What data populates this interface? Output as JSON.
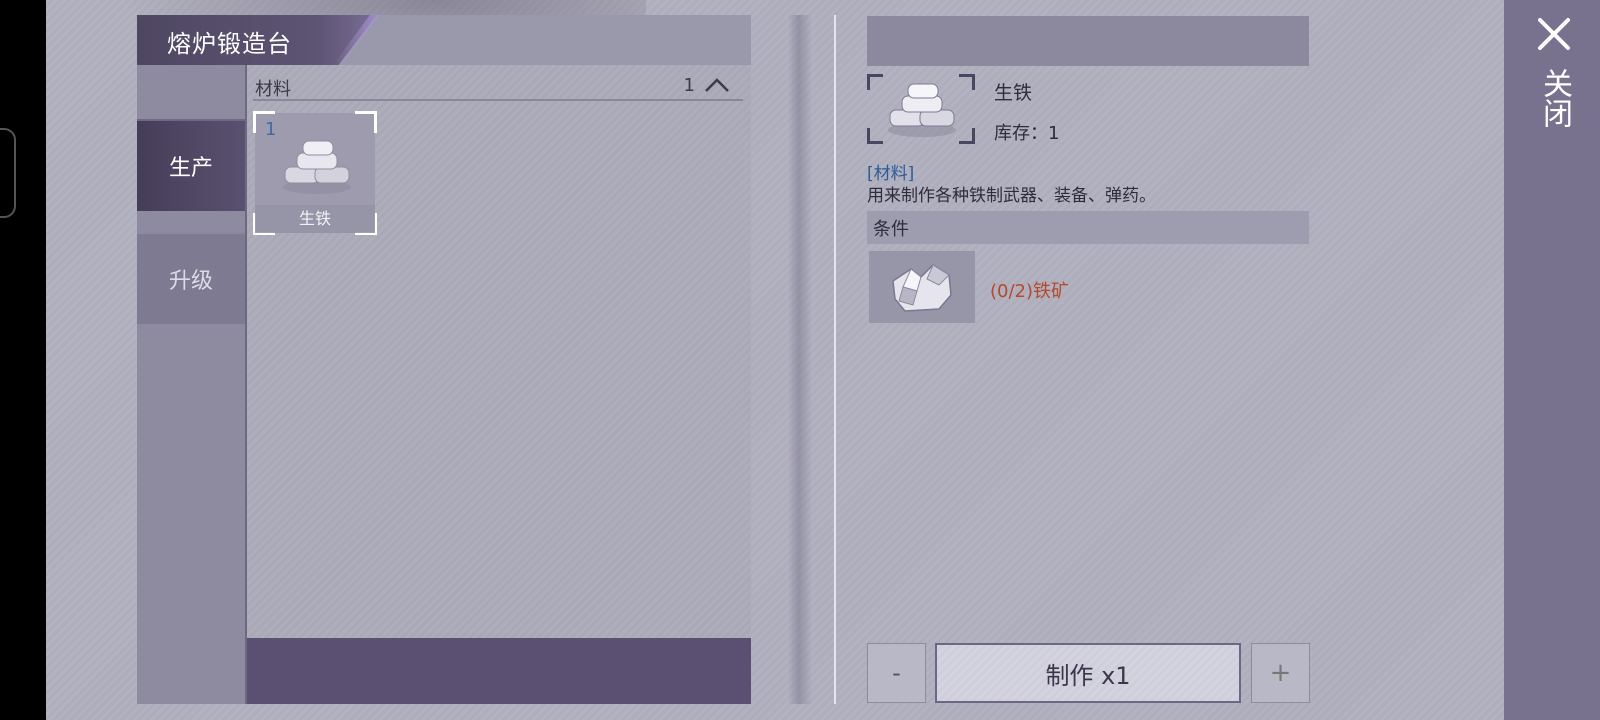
{
  "title": "熔炉锻造台",
  "tabs": [
    {
      "label": "生产",
      "active": true
    },
    {
      "label": "升级",
      "active": false
    }
  ],
  "list": {
    "header_label": "材料",
    "header_count": "1",
    "items": [
      {
        "qty": "1",
        "label": "生铁",
        "icon": "pig-iron-icon"
      }
    ]
  },
  "detail": {
    "name": "生铁",
    "stock": "库存：1",
    "category": "[材料]",
    "description": "用来制作各种铁制武器、装备、弹药。",
    "conditions_label": "条件",
    "requirement": "(0/2)铁矿",
    "requirement_icon": "iron-ore-icon"
  },
  "actions": {
    "minus": "-",
    "make": "制作 x1",
    "plus": "+"
  },
  "close_label": "关闭",
  "colors": {
    "accent_dark": "#4e4762",
    "requirement_text": "#b5492c",
    "category_text": "#2b5c96",
    "qty_text": "#3f6aa6"
  }
}
